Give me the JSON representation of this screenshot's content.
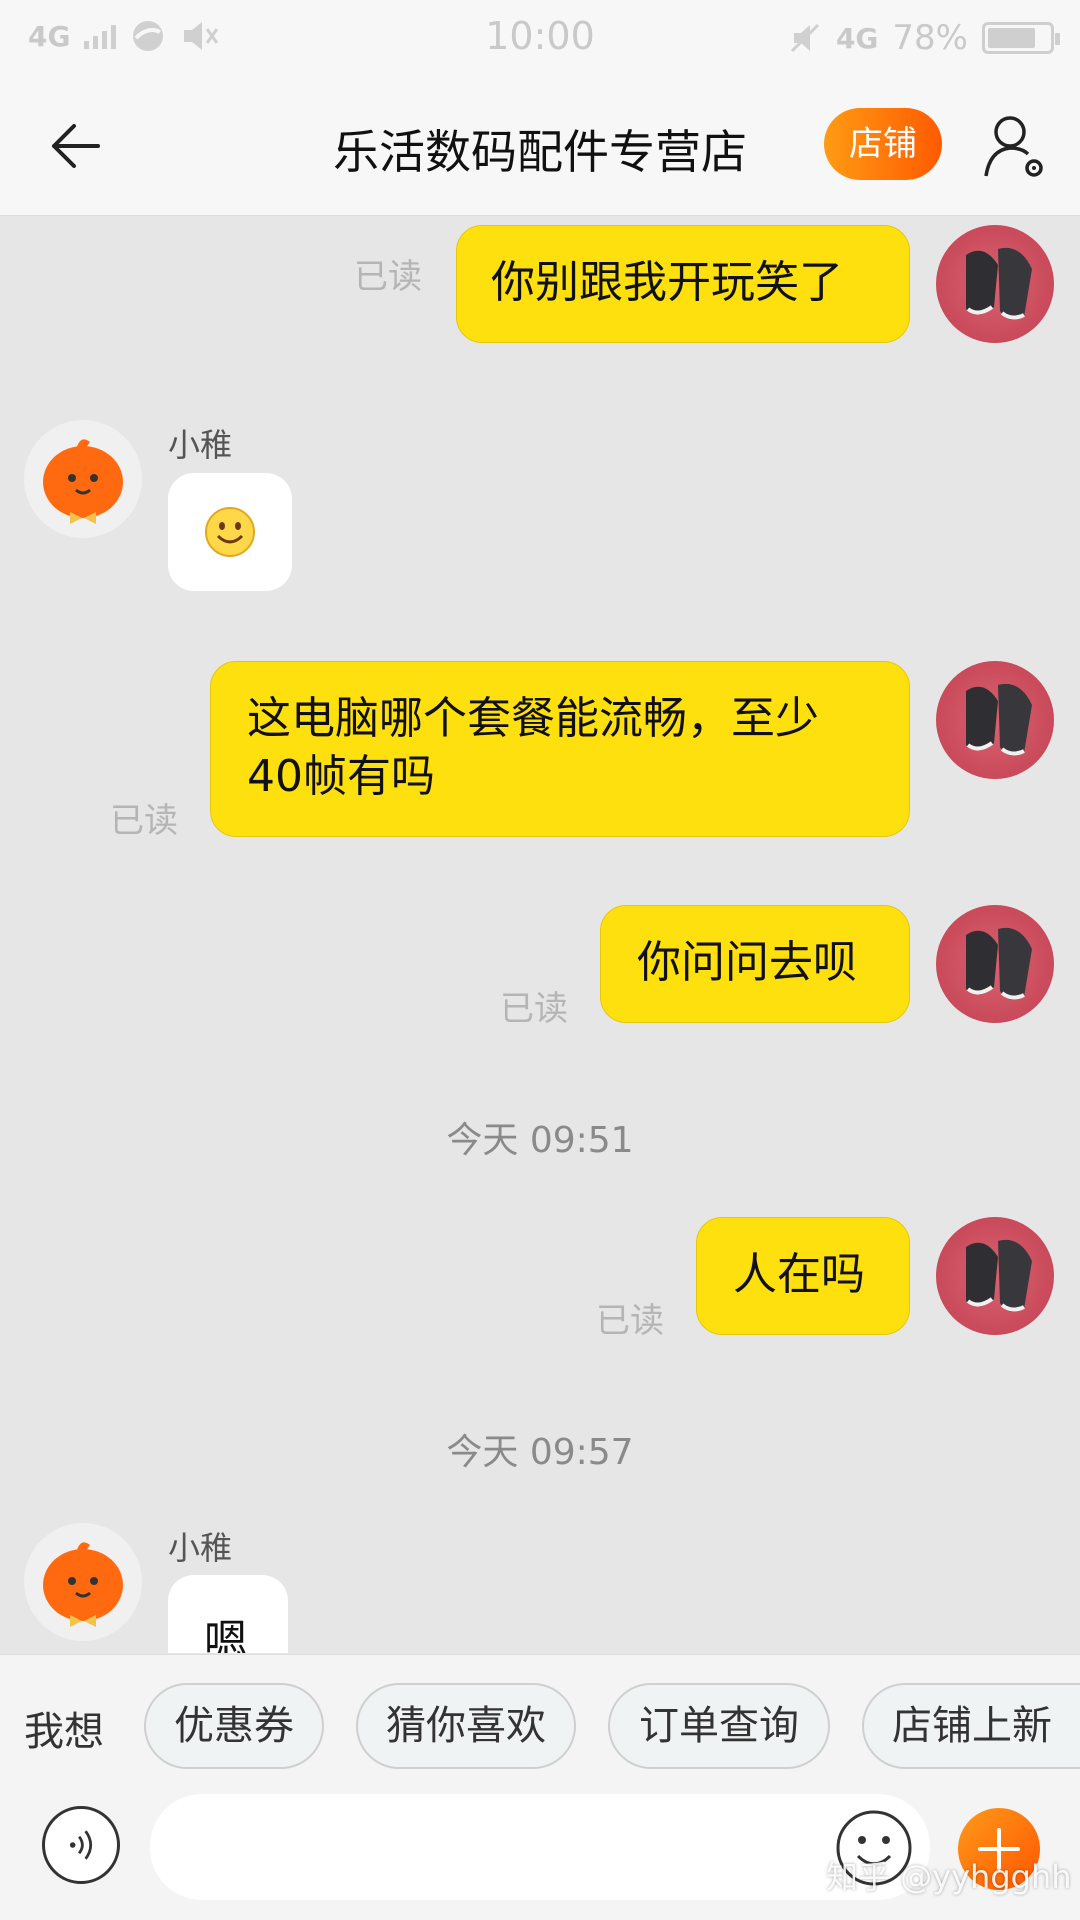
{
  "status_bar": {
    "network_left": "4G",
    "time": "10:00",
    "network_right": "4G",
    "battery_text": "78%",
    "battery_level": 0.78
  },
  "header": {
    "title": "乐活数码配件专营店",
    "shop_button": "店铺"
  },
  "messages": [
    {
      "side": "right",
      "text": "你别跟我开玩笑了",
      "status": "已读"
    },
    {
      "side": "left",
      "sender": "小稚",
      "content": "smiley-emoji"
    },
    {
      "side": "right",
      "text_line1": "这电脑哪个套餐能流畅，至少",
      "text_line2": "40帧有吗",
      "status": "已读"
    },
    {
      "side": "right",
      "text": "你问问去呗",
      "status": "已读"
    },
    {
      "type": "time",
      "text": "今天  09:51"
    },
    {
      "side": "right",
      "text": "人在吗",
      "status": "已读"
    },
    {
      "type": "time",
      "text": "今天  09:57"
    },
    {
      "side": "left",
      "sender": "小稚",
      "text": "嗯"
    }
  ],
  "quick_replies": {
    "label": "我想",
    "chips": [
      "优惠券",
      "猜你喜欢",
      "订单查询",
      "店铺上新"
    ]
  },
  "input": {
    "placeholder": ""
  },
  "watermark": "知乎 @yyhgghh",
  "colors": {
    "accent_orange": "#ff6a00",
    "bubble_yellow": "#ffe00f",
    "background": "#e6e6e6"
  },
  "icons": [
    "back-arrow-icon",
    "profile-settings-icon",
    "voice-icon",
    "emoji-icon",
    "plus-icon",
    "user-avatar",
    "shop-avatar"
  ]
}
